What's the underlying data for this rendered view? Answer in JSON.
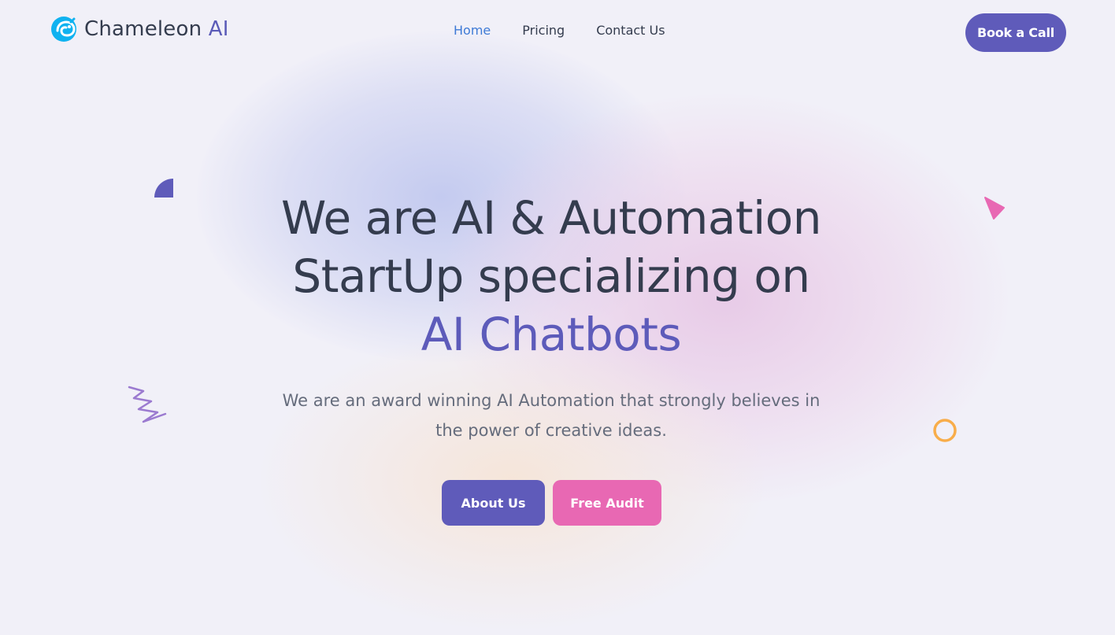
{
  "brand": {
    "name": "Chameleon",
    "name_accent": "AI",
    "logo_icon": "chameleon-logo-icon"
  },
  "nav": {
    "items": [
      {
        "label": "Home",
        "active": true
      },
      {
        "label": "Pricing",
        "active": false
      },
      {
        "label": "Contact Us",
        "active": false
      }
    ],
    "cta_label": "Book a Call"
  },
  "hero": {
    "title_line_1": "We are AI & Automation",
    "title_line_2": "StartUp specializing on",
    "title_accent": "AI Chatbots",
    "subtitle_line_1": "We are an award winning AI Automation that strongly believes in",
    "subtitle_line_2": "the power of creative ideas.",
    "primary_button": "About Us",
    "secondary_button": "Free Audit"
  },
  "decorations": {
    "shapes": [
      "quarter-circle-shape",
      "squiggle-shape",
      "triangle-shape",
      "ring-shape"
    ]
  },
  "colors": {
    "primary": "#5f5bba",
    "accent_pink": "#e868b3",
    "nav_active": "#3e7ad6",
    "text_dark": "#343c4e",
    "text_muted": "#656c7c",
    "ring_orange": "#f8ad4a",
    "squiggle_purple": "#9b7ad0",
    "logo_cyan": "#0fb2f0"
  }
}
